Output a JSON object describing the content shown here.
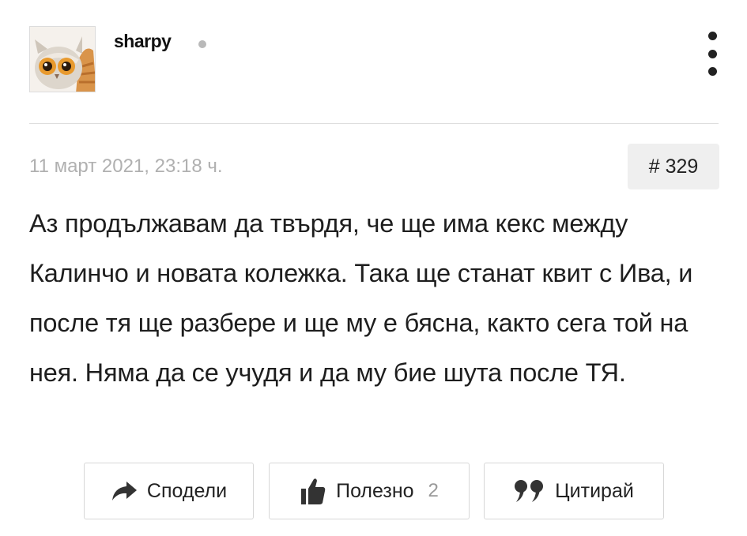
{
  "post": {
    "author": {
      "username": "sharpy",
      "avatar_icon": "owl-cat-avatar",
      "online_status_color": "#b9b9b9"
    },
    "menu_icon": "more-vertical-icon",
    "timestamp": "11 март 2021, 23:18 ч.",
    "post_number": "# 329",
    "text": "Аз продължавам да твърдя, че ще има кекс между Калинчо и новата колежка. Така ще станат квит с Ива, и после тя ще разбере и ще му е бясна, както сега той на нея. Няма да се учудя и да му бие шута после ТЯ."
  },
  "actions": {
    "share": {
      "label": "Сподели",
      "icon": "share-arrow-icon"
    },
    "useful": {
      "label": "Полезно",
      "count": "2",
      "icon": "thumbs-up-icon"
    },
    "quote": {
      "label": "Цитирай",
      "icon": "quote-icon"
    }
  }
}
